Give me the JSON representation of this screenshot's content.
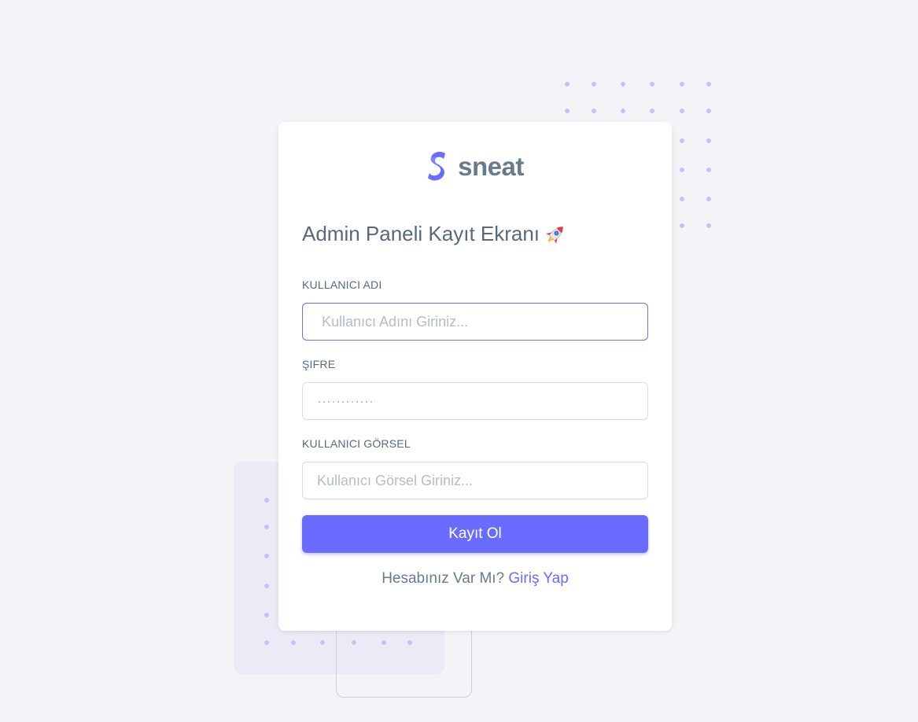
{
  "brand": {
    "name": "sneat",
    "logo_icon": "sneat-s-logo-icon",
    "accent": "#696cff"
  },
  "title": {
    "text": "Admin Paneli Kayıt Ekranı",
    "icon": "rocket-icon"
  },
  "form": {
    "username": {
      "label": "KULLANICI ADI",
      "placeholder": "Kullanıcı Adını Giriniz...",
      "value": ""
    },
    "password": {
      "label": "ŞIFRE",
      "placeholder": "············",
      "value": ""
    },
    "image": {
      "label": "KULLANICI GÖRSEL",
      "placeholder": "Kullanıcı Görsel Giriniz...",
      "value": ""
    },
    "submit_label": "Kayıt Ol"
  },
  "footer": {
    "question": "Hesabınız Var Mı?",
    "link_label": "Giriş Yap"
  },
  "colors": {
    "background": "#f4f4f8",
    "primary": "#696cff",
    "text": "#566a7f",
    "dot": "#c6c1f7"
  }
}
